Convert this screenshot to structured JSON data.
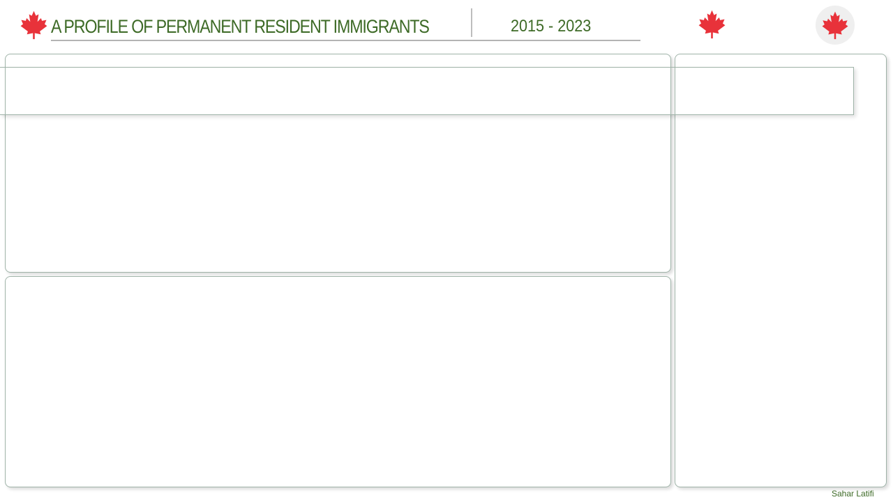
{
  "header": {
    "title": "A PROFILE OF PERMANENT RESIDENT IMMIGRANTS",
    "year_range": "2015 - 2023"
  },
  "footer": {
    "author": "Sahar Latifi"
  },
  "icons": {
    "title_icon": "maple-leaf-icon",
    "standalone_icon": "maple-leaf-icon",
    "round_button_icon": "maple-leaf-icon"
  },
  "colors": {
    "title_text": "#3d6a26",
    "maple_leaf": "#e8323a",
    "panel_border": "#9fb3a8",
    "icon_button_bg": "#efefef"
  }
}
